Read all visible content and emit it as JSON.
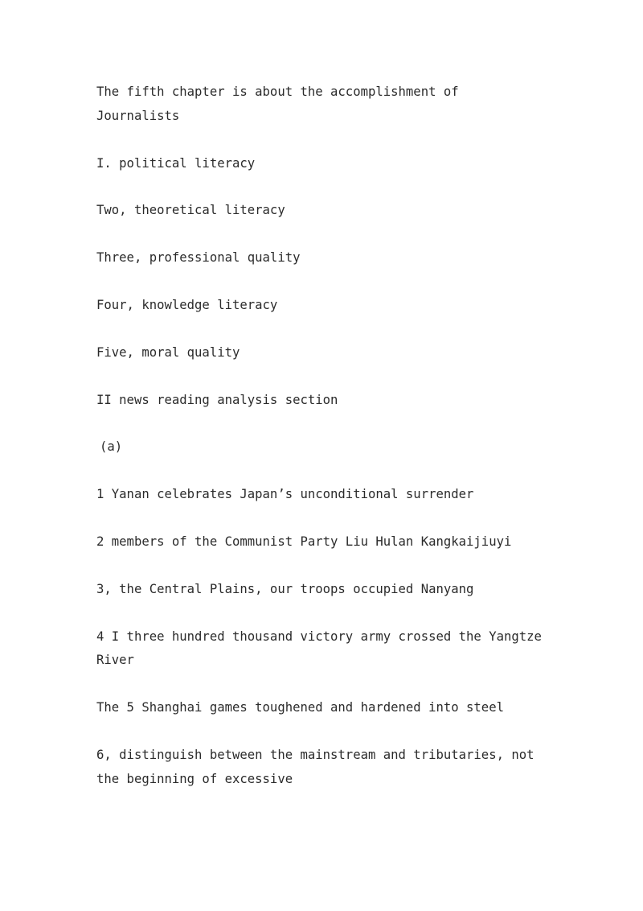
{
  "document": {
    "background_color": "#ffffff",
    "text_color": "#2b2b2b",
    "paragraphs": [
      {
        "id": "p1",
        "text": "The fifth chapter is about the accomplishment of Journalists",
        "indent": false
      },
      {
        "id": "p2",
        "text": "I. political literacy",
        "indent": false
      },
      {
        "id": "p3",
        "text": "Two, theoretical literacy",
        "indent": false
      },
      {
        "id": "p4",
        "text": "Three, professional quality",
        "indent": false
      },
      {
        "id": "p5",
        "text": "Four, knowledge literacy",
        "indent": false
      },
      {
        "id": "p6",
        "text": "Five, moral quality",
        "indent": false
      },
      {
        "id": "p7",
        "text": "II news reading analysis section",
        "indent": false
      },
      {
        "id": "p8",
        "text": "(a)",
        "indent": true
      },
      {
        "id": "p9",
        "text": "1 Yanan celebrates Japan’s unconditional surrender",
        "indent": false
      },
      {
        "id": "p10",
        "text": "2 members of the Communist Party Liu Hulan Kangkaijiuyi",
        "indent": false
      },
      {
        "id": "p11",
        "text": "3, the Central Plains, our troops occupied Nanyang",
        "indent": false
      },
      {
        "id": "p12",
        "text": "4 I three hundred thousand victory army crossed the Yangtze River",
        "indent": false
      },
      {
        "id": "p13",
        "text": "The 5 Shanghai games toughened and hardened into steel",
        "indent": false
      },
      {
        "id": "p14",
        "text": "6, distinguish between the mainstream and tributaries, not the beginning of excessive",
        "indent": false
      }
    ]
  }
}
